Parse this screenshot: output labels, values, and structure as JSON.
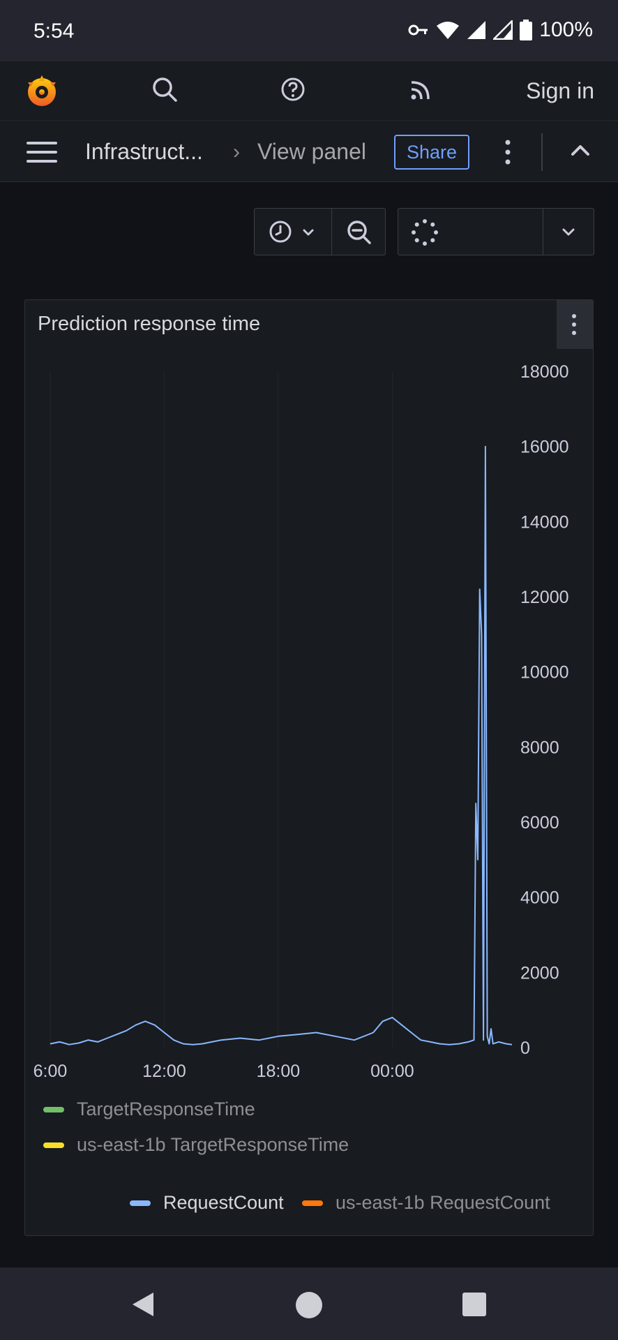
{
  "status_bar": {
    "time": "5:54",
    "battery": "100%"
  },
  "topnav": {
    "sign_in": "Sign in"
  },
  "toolbar": {
    "breadcrumb_root": "Infrastruct...",
    "breadcrumb_separator": "›",
    "breadcrumb_current": "View panel",
    "share_label": "Share"
  },
  "panel": {
    "title": "Prediction response time"
  },
  "chart_data": {
    "type": "line",
    "xlabel": "",
    "ylabel": "",
    "x_tick_labels": [
      "6:00",
      "12:00",
      "18:00",
      "00:00"
    ],
    "y_ticks": [
      "0",
      "2000",
      "4000",
      "6000",
      "8000",
      "10000",
      "12000",
      "14000",
      "16000",
      "18000"
    ],
    "ylim": [
      0,
      18000
    ],
    "x_range_hours": [
      6,
      30.3
    ],
    "grid": true,
    "legend_position": "bottom",
    "series": [
      {
        "name": "TargetResponseTime",
        "color": "#73bf69",
        "x": [],
        "values": []
      },
      {
        "name": "us-east-1b TargetResponseTime",
        "color": "#fade2a",
        "x": [],
        "values": []
      },
      {
        "name": "RequestCount",
        "color": "#8ab8ff",
        "x": [
          6.0,
          6.5,
          7.0,
          7.5,
          8.0,
          8.5,
          9.0,
          9.5,
          10.0,
          10.5,
          11.0,
          11.5,
          12.0,
          12.5,
          13.0,
          13.5,
          14.0,
          14.5,
          15.0,
          16.0,
          17.0,
          18.0,
          19.0,
          20.0,
          21.0,
          22.0,
          23.0,
          23.5,
          24.0,
          24.5,
          25.0,
          25.5,
          26.0,
          26.5,
          27.0,
          27.5,
          28.0,
          28.3,
          28.4,
          28.5,
          28.6,
          28.7,
          28.8,
          28.9,
          29.0,
          29.1,
          29.2,
          29.3,
          29.6,
          30.0,
          30.3
        ],
        "values": [
          100,
          150,
          80,
          120,
          200,
          150,
          250,
          350,
          450,
          600,
          700,
          600,
          400,
          200,
          100,
          80,
          100,
          150,
          200,
          250,
          200,
          300,
          350,
          400,
          300,
          200,
          400,
          700,
          800,
          600,
          400,
          200,
          150,
          100,
          80,
          100,
          150,
          200,
          6500,
          5000,
          12200,
          11000,
          200,
          16000,
          300,
          100,
          500,
          100,
          150,
          100,
          80
        ]
      },
      {
        "name": "us-east-1b RequestCount",
        "color": "#ff780a",
        "x": [],
        "values": []
      }
    ]
  }
}
